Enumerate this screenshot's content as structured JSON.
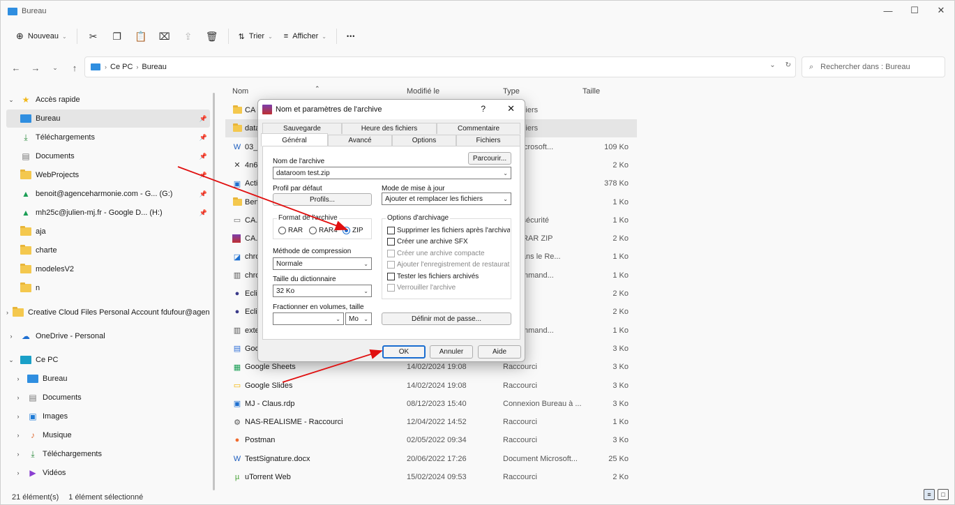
{
  "window": {
    "title": "Bureau"
  },
  "toolbar": {
    "new_label": "Nouveau",
    "sort_label": "Trier",
    "view_label": "Afficher",
    "more_label": "•••"
  },
  "address": {
    "crumbs": [
      "Ce PC",
      "Bureau"
    ],
    "search_placeholder": "Rechercher dans : Bureau"
  },
  "sidebar": {
    "items": [
      {
        "label": "Accès rapide"
      },
      {
        "label": "Bureau"
      },
      {
        "label": "Téléchargements"
      },
      {
        "label": "Documents"
      },
      {
        "label": "WebProjects"
      },
      {
        "label": "benoit@agenceharmonie.com - G... (G:)"
      },
      {
        "label": "mh25c@julien-mj.fr - Google D... (H:)"
      },
      {
        "label": "aja"
      },
      {
        "label": "charte"
      },
      {
        "label": "modelesV2"
      },
      {
        "label": "n"
      },
      {
        "label": "Creative Cloud Files Personal Account fdufour@agenceh"
      },
      {
        "label": "OneDrive - Personal"
      },
      {
        "label": "Ce PC"
      },
      {
        "label": "Bureau"
      },
      {
        "label": "Documents"
      },
      {
        "label": "Images"
      },
      {
        "label": "Musique"
      },
      {
        "label": "Téléchargements"
      },
      {
        "label": "Vidéos"
      }
    ]
  },
  "columns": {
    "name": "Nom",
    "modified": "Modifié le",
    "type": "Type",
    "size": "Taille"
  },
  "files": [
    {
      "name": "CA",
      "date": "",
      "type": "de fichiers",
      "size": ""
    },
    {
      "name": "data",
      "date": "",
      "type": "de fichiers",
      "size": ""
    },
    {
      "name": "03_2",
      "date": "",
      "type": "ent Microsoft...",
      "size": "109 Ko"
    },
    {
      "name": "4n6",
      "date": "",
      "type": "rci",
      "size": "2 Ko"
    },
    {
      "name": "Acti",
      "date": "",
      "type": "PNG",
      "size": "378 Ko"
    },
    {
      "name": "Ben",
      "date": "",
      "type": "rci",
      "size": "1 Ko"
    },
    {
      "name": "CA.c",
      "date": "",
      "type": "at de sécurité",
      "size": "1 Ko"
    },
    {
      "name": "CA.z",
      "date": "",
      "type": "e WinRAR ZIP",
      "size": "2 Ko"
    },
    {
      "name": "chro",
      "date": "",
      "type": "tion dans le Re...",
      "size": "1 Ko"
    },
    {
      "name": "chro",
      "date": "",
      "type": "de command...",
      "size": "1 Ko"
    },
    {
      "name": "Eclip",
      "date": "",
      "type": "rci",
      "size": "2 Ko"
    },
    {
      "name": "Eclip",
      "date": "",
      "type": "rci",
      "size": "2 Ko"
    },
    {
      "name": "exte",
      "date": "",
      "type": "de command...",
      "size": "1 Ko"
    },
    {
      "name": "Goo",
      "date": "",
      "type": "rci",
      "size": "3 Ko"
    },
    {
      "name": "Google Sheets",
      "date": "14/02/2024 19:08",
      "type": "Raccourci",
      "size": "3 Ko"
    },
    {
      "name": "Google Slides",
      "date": "14/02/2024 19:08",
      "type": "Raccourci",
      "size": "3 Ko"
    },
    {
      "name": "MJ - Claus.rdp",
      "date": "08/12/2023 15:40",
      "type": "Connexion Bureau à ...",
      "size": "3 Ko"
    },
    {
      "name": "NAS-REALISME - Raccourci",
      "date": "12/04/2022 14:52",
      "type": "Raccourci",
      "size": "1 Ko"
    },
    {
      "name": "Postman",
      "date": "02/05/2022 09:34",
      "type": "Raccourci",
      "size": "3 Ko"
    },
    {
      "name": "TestSignature.docx",
      "date": "20/06/2022 17:26",
      "type": "Document Microsoft...",
      "size": "25 Ko"
    },
    {
      "name": "uTorrent Web",
      "date": "15/02/2024 09:53",
      "type": "Raccourci",
      "size": "2 Ko"
    }
  ],
  "status": {
    "count": "21 élément(s)",
    "selected": "1 élément sélectionné"
  },
  "dialog": {
    "title": "Nom et paramètres de l'archive",
    "help": "?",
    "tabs_row1": [
      "Sauvegarde",
      "Heure des fichiers",
      "Commentaire"
    ],
    "tabs_row2": [
      "Général",
      "Avancé",
      "Options",
      "Fichiers"
    ],
    "archive_name_label": "Nom de l'archive",
    "browse": "Parcourir...",
    "archive_name_value": "dataroom test.zip",
    "profile_label": "Profil par défaut",
    "profiles_btn": "Profils...",
    "update_mode_label": "Mode de mise à jour",
    "update_mode_value": "Ajouter et remplacer les fichiers",
    "format_label": "Format de l'archive",
    "formats": [
      "RAR",
      "RAR4",
      "ZIP"
    ],
    "options_label": "Options d'archivage",
    "options": [
      "Supprimer les fichiers après l'archivage",
      "Créer une archive SFX",
      "Créer une archive compacte",
      "Ajouter l'enregistrement de restauratic",
      "Tester les fichiers archivés",
      "Verrouiller l'archive"
    ],
    "method_label": "Méthode de compression",
    "method_value": "Normale",
    "dict_label": "Taille du dictionnaire",
    "dict_value": "32 Ko",
    "split_label": "Fractionner en volumes, taille",
    "split_unit": "Mo",
    "password_btn": "Définir mot de passe...",
    "ok": "OK",
    "cancel": "Annuler",
    "help_btn": "Aide"
  },
  "colors": {
    "accent": "#1a6dd0",
    "annotation_arrow": "#e01010",
    "folder": "#f4c84e"
  }
}
